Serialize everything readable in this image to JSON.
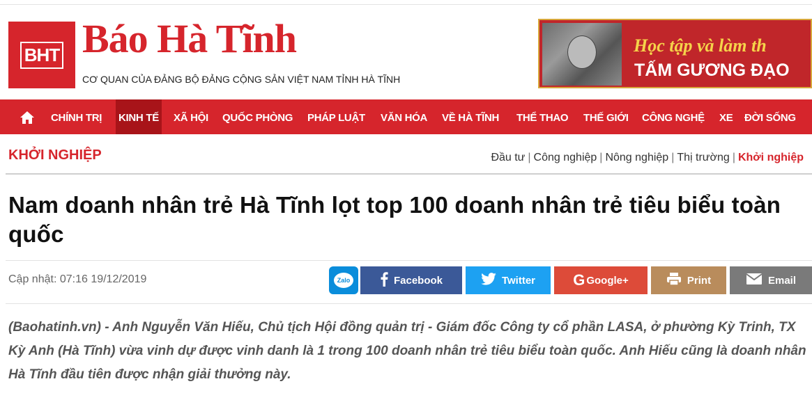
{
  "header": {
    "logo_text": "BHT",
    "site_title": "Báo Hà Tĩnh",
    "slogan": "CƠ QUAN CỦA ĐẢNG BỘ ĐẢNG CỘNG SẢN VIỆT NAM TỈNH HÀ TĨNH",
    "banner": {
      "line1": "Học tập và làm th",
      "line2": "TẤM GƯƠNG ĐẠO"
    }
  },
  "nav": {
    "items": [
      {
        "label": "CHÍNH TRỊ"
      },
      {
        "label": "KINH TẾ",
        "active": true
      },
      {
        "label": "XÃ HỘI"
      },
      {
        "label": "QUỐC PHÒNG"
      },
      {
        "label": "PHÁP LUẬT"
      },
      {
        "label": "VĂN HÓA"
      },
      {
        "label": "VỀ HÀ TĨNH"
      },
      {
        "label": "THỂ THAO"
      },
      {
        "label": "THẾ GIỚI"
      },
      {
        "label": "CÔNG NGHỆ"
      },
      {
        "label": "XE"
      },
      {
        "label": "ĐỜI SỐNG"
      }
    ]
  },
  "section": {
    "title": "KHỞI NGHIỆP",
    "subnav": [
      {
        "label": "Đầu tư"
      },
      {
        "label": "Công nghiệp"
      },
      {
        "label": "Nông nghiệp"
      },
      {
        "label": "Thị trường"
      },
      {
        "label": "Khởi nghiệp",
        "active": true
      }
    ]
  },
  "article": {
    "headline": "Nam doanh nhân trẻ Hà Tĩnh lọt top 100 doanh nhân trẻ tiêu biểu toàn quốc",
    "updated": "Cập nhật: 07:16 19/12/2019",
    "sapo": "(Baohatinh.vn) - Anh Nguyễn Văn Hiếu, Chủ tịch Hội đồng quản trị - Giám đốc Công ty cổ phần LASA, ở phường Kỳ Trinh, TX Kỳ Anh (Hà Tĩnh) vừa vinh dự được vinh danh là 1 trong 100 doanh nhân trẻ tiêu biểu toàn quốc. Anh Hiếu cũng là doanh nhân Hà Tĩnh đầu tiên được nhận giải thưởng này."
  },
  "share": {
    "zalo": "Zalo",
    "facebook": "Facebook",
    "twitter": "Twitter",
    "google": "Google+",
    "print": "Print",
    "email": "Email"
  },
  "colors": {
    "brand_red": "#d6252c",
    "nav_active": "#a81419",
    "facebook": "#3b5998",
    "twitter": "#1da1f2",
    "google": "#dd4b39",
    "print": "#b98c5c",
    "email": "#7a7a7a",
    "zalo": "#0a8ddb"
  },
  "icons": {
    "home": "home-icon",
    "facebook": "facebook-icon",
    "twitter": "twitter-icon",
    "google": "google-plus-icon",
    "print": "printer-icon",
    "email": "envelope-icon",
    "zalo": "zalo-icon"
  }
}
